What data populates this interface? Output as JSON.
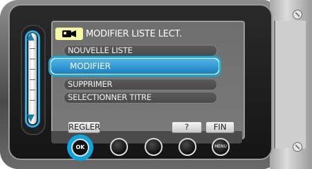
{
  "header": {
    "icon": "video-camera-icon",
    "title": "MODIFIER LISTE LECT."
  },
  "menu": {
    "items": [
      {
        "label": "NOUVELLE LISTE"
      },
      {
        "label": "MODIFIER",
        "selected": true
      },
      {
        "label": "SUPPRIMER"
      },
      {
        "label": "SELECTIONNER TITRE"
      }
    ]
  },
  "softkeys": {
    "set": "REGLER",
    "help": "?",
    "end": "FIN"
  },
  "buttons": {
    "ok": "OK",
    "menu": "MENU"
  },
  "colors": {
    "highlight": "#17a9dd",
    "selected_bar": "#2b8fd0",
    "header_bg": "#f4f7a2"
  }
}
